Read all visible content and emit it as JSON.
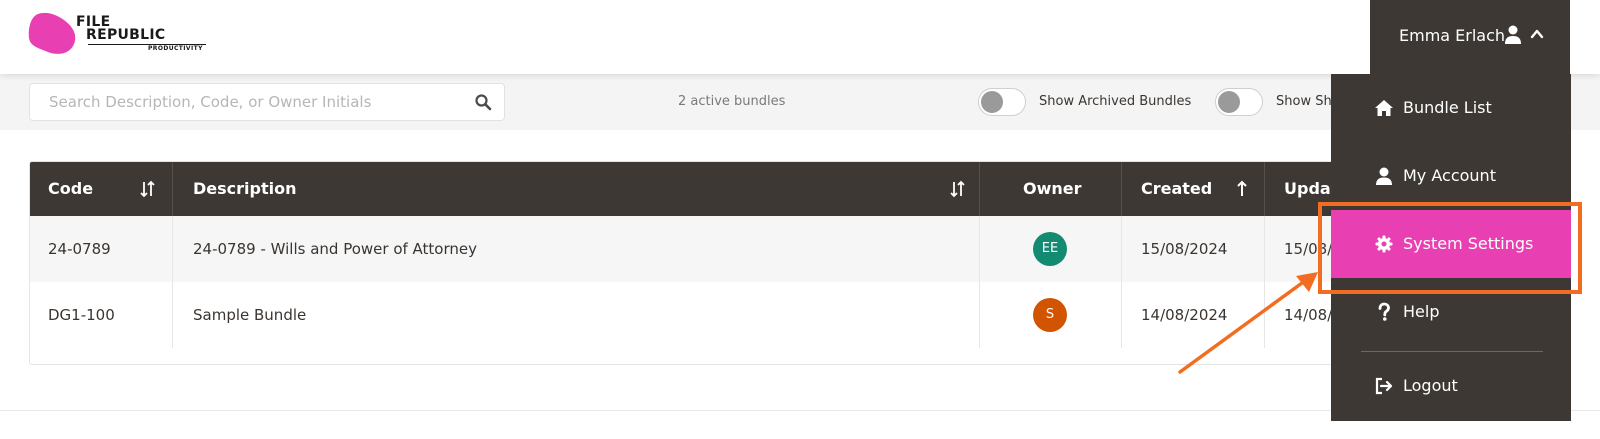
{
  "brand": {
    "line1": "FILE",
    "line2": "REPUBLIC",
    "tagline": "PRODUCTIVITY",
    "color": "#e83fb2"
  },
  "search": {
    "placeholder": "Search Description, Code, or Owner Initials",
    "value": "",
    "icon": "search-icon"
  },
  "bundle_count": "2 active bundles",
  "toggles": [
    {
      "label": "Show Archived Bundles",
      "on": false
    },
    {
      "label": "Show Sh",
      "on": false
    }
  ],
  "table": {
    "headers": {
      "code": "Code",
      "description": "Description",
      "owner": "Owner",
      "created": "Created",
      "updated": "Updat"
    },
    "rows": [
      {
        "code": "24-0789",
        "description": "24-0789 - Wills and Power of Attorney",
        "owner": "EE",
        "owner_color": "#138a72",
        "created": "15/08/2024",
        "updated": "15/08/"
      },
      {
        "code": "DG1-100",
        "description": "Sample Bundle",
        "owner": "S",
        "owner_color": "#d35400",
        "created": "14/08/2024",
        "updated": "14/08/"
      }
    ]
  },
  "user": {
    "name": "Emma Erlach",
    "icon": "user-icon",
    "chevron": "chevron-up-icon"
  },
  "menu": {
    "items": [
      {
        "label": "Bundle List",
        "icon": "home-icon",
        "active": false
      },
      {
        "label": "My Account",
        "icon": "user-icon",
        "active": false
      },
      {
        "label": "System Settings",
        "icon": "gear-icon",
        "active": true
      },
      {
        "label": "Help",
        "icon": "question-icon",
        "active": false
      },
      {
        "label": "Logout",
        "icon": "logout-icon",
        "active": false
      }
    ]
  },
  "colors": {
    "dark": "#3d3833",
    "accent": "#e83fb2",
    "annotation": "#f26d21"
  }
}
